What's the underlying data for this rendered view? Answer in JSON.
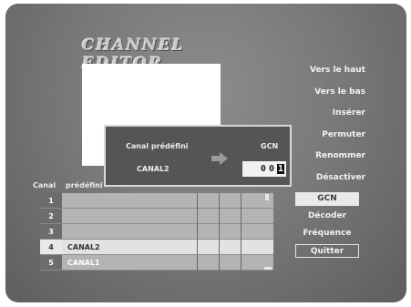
{
  "title": "CHANNEL EDITOR",
  "menu": [
    {
      "label": "Vers le haut"
    },
    {
      "label": "Vers le bas"
    },
    {
      "label": "Insérer"
    },
    {
      "label": "Permuter"
    },
    {
      "label": "Renommer"
    },
    {
      "label": "Désactiver"
    },
    {
      "label": "GCN"
    },
    {
      "label": "Décoder"
    },
    {
      "label": "Fréquence"
    },
    {
      "label": "Quitter"
    }
  ],
  "list": {
    "headers": {
      "canal": "Canal",
      "predefini": "prédéfini"
    },
    "rows": [
      {
        "num": "1",
        "name": ""
      },
      {
        "num": "2",
        "name": ""
      },
      {
        "num": "3",
        "name": ""
      },
      {
        "num": "4",
        "name": "CANAL2"
      },
      {
        "num": "5",
        "name": "CANAL1"
      }
    ]
  },
  "dialog": {
    "label_left": "Canal prédéfini",
    "label_right": "GCN",
    "channel": "CANAL2",
    "digit1": "0",
    "digit2": "0",
    "digit3": "1"
  }
}
